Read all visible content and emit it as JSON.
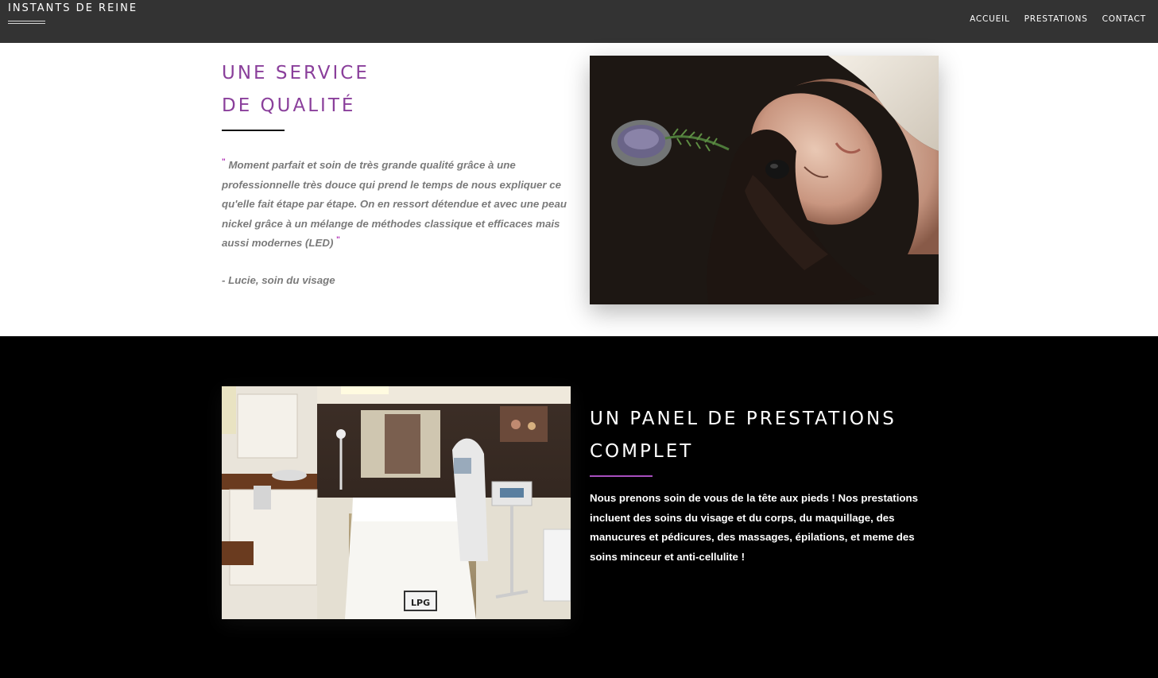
{
  "header": {
    "brand": "INSTANTS DE REINE",
    "nav": [
      "ACCUEIL",
      "PRESTATIONS",
      "CONTACT"
    ]
  },
  "quality": {
    "title_lines": [
      "UNE SERVICE",
      "DE QUALITÉ"
    ],
    "quote_mark_open": "\"",
    "quote": "Moment parfait et soin de très grande qualité grâce à une professionnelle très douce qui prend le temps de nous expliquer ce qu'elle fait étape par étape. On en ressort détendue et avec une peau nickel grâce à un mélange de méthodes classique et efficaces mais aussi modernes (LED)",
    "quote_mark_close": "\"",
    "author": "- Lucie, soin du visage"
  },
  "services": {
    "title_lines": [
      "UN PANEL DE PRESTATIONS",
      "COMPLET"
    ],
    "description": "Nous prenons soin de vous de la tête aux pieds ! Nos prestations incluent des soins du visage et du corps, du maquillage, des manucures et pédicures, des massages, épilations, et meme des soins minceur et anti-cellulite !"
  },
  "colors": {
    "header_bg": "#333333",
    "accent_purple": "#8a3f9b",
    "rule_purple": "#a84fbf",
    "section_black": "#000000"
  }
}
